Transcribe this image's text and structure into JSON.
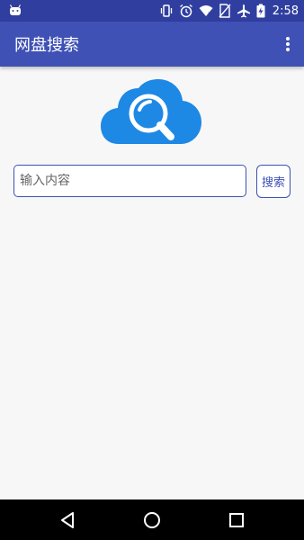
{
  "status_bar": {
    "time": "2:58",
    "icons": [
      "android-icon",
      "vibrate-icon",
      "alarm-icon",
      "wifi-icon",
      "no-sim-icon",
      "airplane-mode-icon",
      "battery-charging-icon"
    ]
  },
  "app_bar": {
    "title": "网盘搜索",
    "menu_icon": "more-vert-icon"
  },
  "logo": {
    "icon": "cloud-search-icon",
    "color": "#1e88e5"
  },
  "search": {
    "placeholder": "输入内容",
    "value": "",
    "button_label": "搜索"
  },
  "nav_bar": {
    "icons": [
      "back-icon",
      "home-icon",
      "recents-icon"
    ]
  },
  "colors": {
    "primary": "#3f51b5",
    "primary_dark": "#303f9f",
    "accent": "#1e88e5",
    "background": "#f7f7f7"
  }
}
